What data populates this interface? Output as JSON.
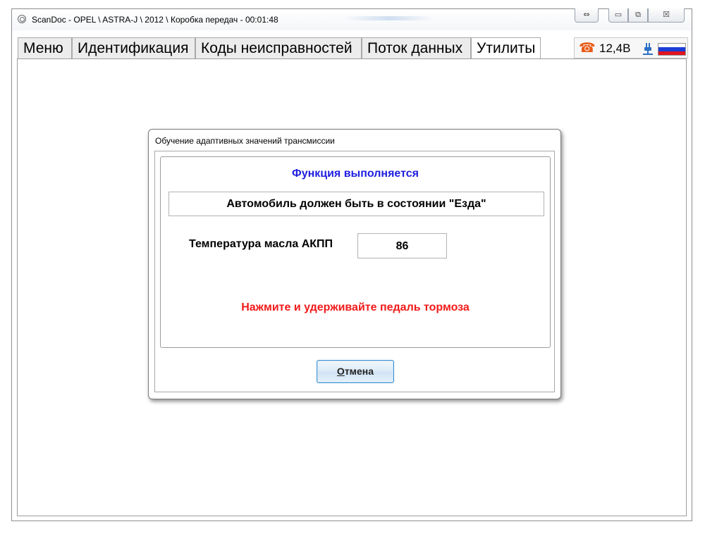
{
  "window": {
    "title": "ScanDoc - OPEL \\ ASTRA-J \\ 2012 \\ Коробка передач - 00:01:48",
    "controls": {
      "swap_icon": "⇔",
      "minimize_icon": "▭",
      "restore_icon": "⧉",
      "close_icon": "☒"
    }
  },
  "tabs": [
    {
      "label": "Меню",
      "active": false
    },
    {
      "label": "Идентификация",
      "active": false
    },
    {
      "label": "Коды неисправностей",
      "active": false
    },
    {
      "label": "Поток данных",
      "active": false
    },
    {
      "label": "Утилиты",
      "active": true
    }
  ],
  "status": {
    "phone_icon": "☎",
    "voltage": "12,4В",
    "connection_icon": "plug-icon",
    "language_flag_colors": [
      "#ffffff",
      "#1a3ed6",
      "#e0141e"
    ]
  },
  "dialog": {
    "title": "Обучение адаптивных значений трансмиссии",
    "status_text": "Функция выполняется",
    "state_text": "Автомобиль должен быть в состоянии \"Езда\"",
    "temp_label": "Температура масла АКПП",
    "temp_value": "86",
    "instruction": "Нажмите и удерживайте педаль тормоза",
    "cancel_label": "Отмена",
    "colors": {
      "status": "#1f1fe0",
      "instruction": "#f21a1a"
    }
  }
}
